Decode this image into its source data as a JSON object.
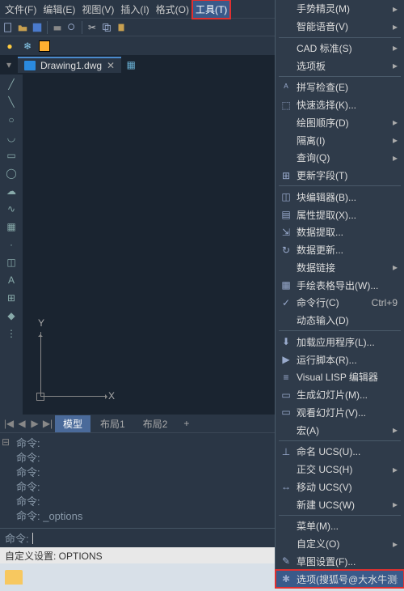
{
  "menubar": {
    "items": [
      "文件(F)",
      "编辑(E)",
      "视图(V)",
      "插入(I)",
      "格式(O)",
      "工具(T)"
    ],
    "highlighted_index": 5
  },
  "doc_tab": {
    "label": "Drawing1.dwg"
  },
  "ucs": {
    "x": "X",
    "y": "Y"
  },
  "layout_tabs": {
    "nav": [
      "|◀",
      "◀",
      "▶",
      "▶|"
    ],
    "tabs": [
      "模型",
      "布局1",
      "布局2"
    ],
    "active_index": 0,
    "plus": "+"
  },
  "cmd": {
    "lines": [
      "命令:",
      "命令:",
      "命令:",
      "命令:",
      "命令:",
      "命令: _options"
    ],
    "prompt": "命令:"
  },
  "status": {
    "text": "自定义设置: OPTIONS"
  },
  "tools_menu": [
    {
      "type": "item",
      "label": "手势精灵(M)",
      "arrow": true
    },
    {
      "type": "item",
      "label": "智能语音(V)",
      "arrow": true
    },
    {
      "type": "sep"
    },
    {
      "type": "item",
      "label": "CAD 标准(S)",
      "arrow": true
    },
    {
      "type": "item",
      "label": "选项板",
      "arrow": true
    },
    {
      "type": "sep"
    },
    {
      "type": "item",
      "label": "拼写检查(E)",
      "icon": "abc"
    },
    {
      "type": "item",
      "label": "快速选择(K)...",
      "icon": "select"
    },
    {
      "type": "item",
      "label": "绘图顺序(D)",
      "arrow": true
    },
    {
      "type": "item",
      "label": "隔离(I)",
      "arrow": true
    },
    {
      "type": "item",
      "label": "查询(Q)",
      "arrow": true
    },
    {
      "type": "item",
      "label": "更新字段(T)",
      "icon": "field"
    },
    {
      "type": "sep"
    },
    {
      "type": "item",
      "label": "块编辑器(B)...",
      "icon": "block"
    },
    {
      "type": "item",
      "label": "属性提取(X)...",
      "icon": "attr"
    },
    {
      "type": "item",
      "label": "数据提取...",
      "icon": "data"
    },
    {
      "type": "item",
      "label": "数据更新...",
      "icon": "refresh"
    },
    {
      "type": "item",
      "label": "数据链接",
      "arrow": true
    },
    {
      "type": "item",
      "label": "手绘表格导出(W)...",
      "icon": "table"
    },
    {
      "type": "item",
      "label": "命令行(C)",
      "icon": "cmd",
      "shortcut": "Ctrl+9"
    },
    {
      "type": "item",
      "label": "动态输入(D)"
    },
    {
      "type": "sep"
    },
    {
      "type": "item",
      "label": "加载应用程序(L)...",
      "icon": "app"
    },
    {
      "type": "item",
      "label": "运行脚本(R)...",
      "icon": "script"
    },
    {
      "type": "item",
      "label": "Visual LISP 编辑器",
      "icon": "lisp"
    },
    {
      "type": "item",
      "label": "生成幻灯片(M)...",
      "icon": "slide"
    },
    {
      "type": "item",
      "label": "观看幻灯片(V)...",
      "icon": "view"
    },
    {
      "type": "item",
      "label": "宏(A)",
      "arrow": true
    },
    {
      "type": "sep"
    },
    {
      "type": "item",
      "label": "命名 UCS(U)...",
      "icon": "ucs"
    },
    {
      "type": "item",
      "label": "正交 UCS(H)",
      "arrow": true
    },
    {
      "type": "item",
      "label": "移动 UCS(V)",
      "icon": "move"
    },
    {
      "type": "item",
      "label": "新建 UCS(W)",
      "arrow": true
    },
    {
      "type": "sep"
    },
    {
      "type": "item",
      "label": "菜单(M)..."
    },
    {
      "type": "item",
      "label": "自定义(O)",
      "arrow": true
    },
    {
      "type": "item",
      "label": "草图设置(F)...",
      "icon": "sketch"
    },
    {
      "type": "item",
      "label": "选项(搜狐号@大水牛测绘",
      "icon": "gear",
      "highlighted": true
    }
  ]
}
